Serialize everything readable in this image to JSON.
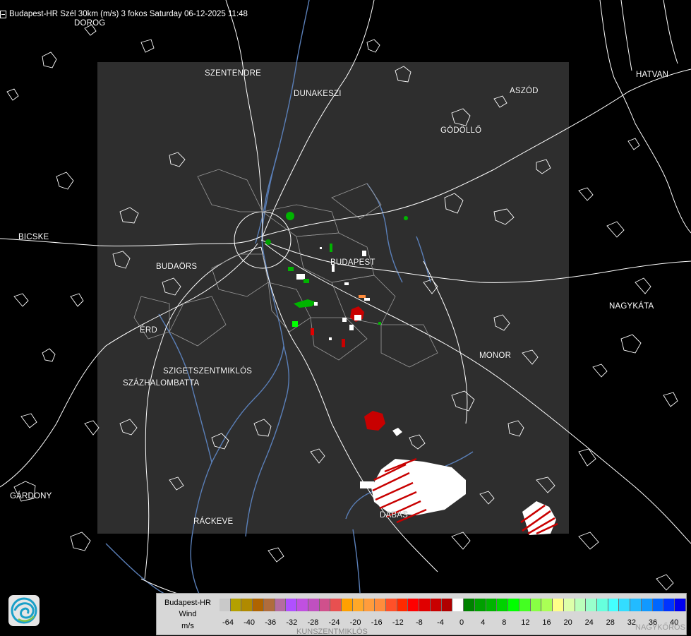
{
  "header": {
    "title": "Budapest-HR Szél 30km (m/s) 3 fokos Saturday 06-12-2025 11:48",
    "icon": "document-icon"
  },
  "map": {
    "background": "#000000",
    "radar_area_color": "#2e2e2e",
    "boundary_color": "#ffffff",
    "river_color": "#5a7fb8",
    "cities": [
      {
        "id": "dorog",
        "label": "DOROG"
      },
      {
        "id": "szentendre",
        "label": "SZENTENDRE"
      },
      {
        "id": "dunakeszi",
        "label": "DUNAKESZI"
      },
      {
        "id": "aszod",
        "label": "ASZÓD"
      },
      {
        "id": "hatvan",
        "label": "HATVAN"
      },
      {
        "id": "godollo",
        "label": "GÖDÖLLŐ"
      },
      {
        "id": "bicske",
        "label": "BICSKE"
      },
      {
        "id": "budaors",
        "label": "BUDAÖRS"
      },
      {
        "id": "budapest",
        "label": "BUDAPEST"
      },
      {
        "id": "nagykata",
        "label": "NAGYKÁTA"
      },
      {
        "id": "erd",
        "label": "ÉRD"
      },
      {
        "id": "monor",
        "label": "MONOR"
      },
      {
        "id": "szigetszentmiklos",
        "label": "SZIGETSZENTMIKLÓS"
      },
      {
        "id": "szazhalombatta",
        "label": "SZÁZHALOMBATTA"
      },
      {
        "id": "gardony",
        "label": "GÁRDONY"
      },
      {
        "id": "rackeve",
        "label": "RÁCKEVE"
      },
      {
        "id": "dabas",
        "label": "DABAS"
      }
    ],
    "partial_labels": {
      "kunszentmiklos": "KUNSZENTMIKLÓS",
      "nagykoros": "NAGYKŐRÖS"
    }
  },
  "legend": {
    "station": "Budapest-HR",
    "quantity": "Wind",
    "unit": "m/s",
    "ticks": [
      "-64",
      "-40",
      "-36",
      "-32",
      "-28",
      "-24",
      "-20",
      "-16",
      "-12",
      "-8",
      "-4",
      "0",
      "4",
      "8",
      "12",
      "16",
      "20",
      "24",
      "28",
      "32",
      "36",
      "40"
    ],
    "colors": [
      "#c9c9c9",
      "#b4a000",
      "#b08a00",
      "#b06400",
      "#b06c3c",
      "#b46ca0",
      "#b050ff",
      "#c050e0",
      "#c050c0",
      "#d0508c",
      "#e85050",
      "#ffa000",
      "#ffa828",
      "#ff9c3c",
      "#ff8c3c",
      "#ff5028",
      "#ff2a00",
      "#ff0000",
      "#e00000",
      "#c80000",
      "#b00000",
      "#ffffff",
      "#008200",
      "#00a000",
      "#00b400",
      "#00d200",
      "#00ff00",
      "#44ff22",
      "#88ff44",
      "#aaff55",
      "#ffff88",
      "#ddffaa",
      "#bbffbb",
      "#99ffcc",
      "#66ffdd",
      "#44ffff",
      "#33ddff",
      "#22bbff",
      "#1199ff",
      "#0066ff",
      "#0033ff",
      "#0000ee"
    ]
  },
  "logo": {
    "icon": "met-service-logo-icon"
  }
}
